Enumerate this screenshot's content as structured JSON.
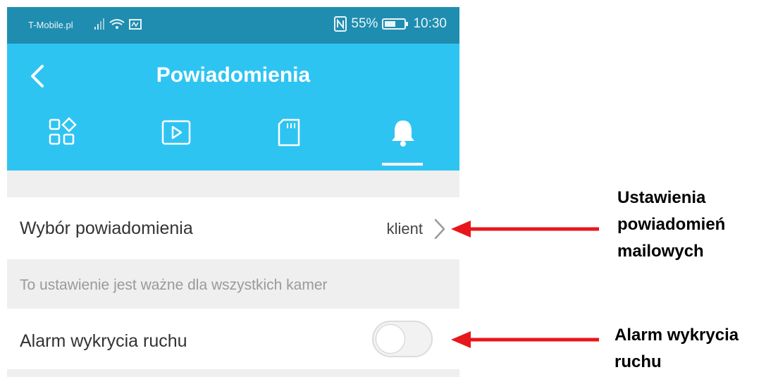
{
  "status_bar": {
    "carrier": "T-Mobile.pl",
    "battery": "55%",
    "time": "10:30"
  },
  "app_bar": {
    "title": "Powiadomienia",
    "tabs": [
      {
        "icon": "apps-icon"
      },
      {
        "icon": "play-icon"
      },
      {
        "icon": "sd-card-icon"
      },
      {
        "icon": "bell-icon",
        "selected": true
      }
    ]
  },
  "settings": {
    "notification_choice_label": "Wybór powiadomienia",
    "notification_choice_value": "klient",
    "note": "To ustawienie jest ważne dla wszystkich kamer",
    "motion_alarm_label": "Alarm wykrycia ruchu",
    "motion_alarm_enabled": false
  },
  "annotations": {
    "email_settings": [
      "Ustawienia",
      "powiadomień",
      "mailowych"
    ],
    "motion_alarm": [
      "Alarm wykrycia",
      "ruchu"
    ]
  },
  "colors": {
    "status_bar": "#1f8db0",
    "app_bar": "#2ec4f2",
    "arrow": "#e8161b"
  }
}
